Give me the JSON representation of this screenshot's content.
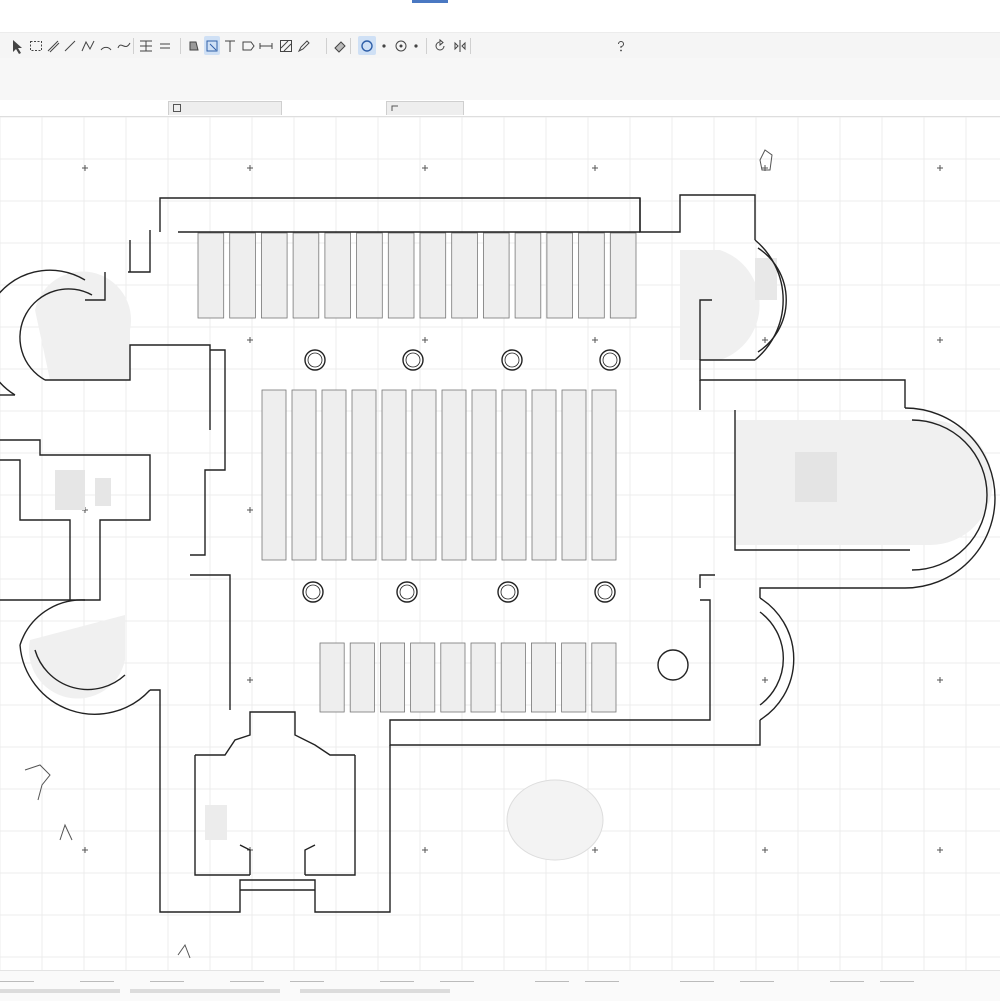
{
  "toolbar": {
    "tools": [
      {
        "icon": "arrow-icon"
      },
      {
        "icon": "marquee-icon"
      },
      {
        "icon": "wall-icon"
      },
      {
        "icon": "line-icon"
      },
      {
        "icon": "polyline-icon"
      },
      {
        "icon": "arc-icon"
      },
      {
        "icon": "spline-icon"
      },
      {
        "icon": "grid-icon"
      },
      {
        "icon": "equal-icon"
      },
      {
        "icon": "fill-icon"
      },
      {
        "icon": "select-icon",
        "active": true
      },
      {
        "icon": "text-icon"
      },
      {
        "icon": "label-icon"
      },
      {
        "icon": "dimension-icon"
      },
      {
        "icon": "hatch-icon"
      },
      {
        "icon": "pen-icon"
      },
      {
        "icon": "erase-icon"
      },
      {
        "icon": "circle-icon",
        "active": true
      },
      {
        "icon": "dot-icon"
      },
      {
        "icon": "target-icon"
      },
      {
        "icon": "dot-icon"
      },
      {
        "icon": "rotate-icon"
      },
      {
        "icon": "mirror-icon"
      },
      {
        "icon": "help-icon"
      }
    ]
  },
  "tabs": [
    {
      "label": ""
    },
    {
      "label": ""
    }
  ],
  "colors": {
    "accent": "#4a78c2",
    "active_tool": "#cfe0f5",
    "drawing_line": "#222222",
    "pew_fill": "#eeeeee",
    "grid": "#ececec"
  }
}
